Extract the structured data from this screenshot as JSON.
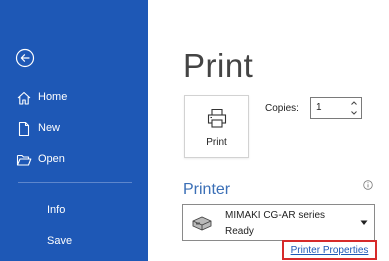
{
  "sidebar": {
    "back_icon": "back-arrow-icon",
    "items": [
      {
        "label": "Home",
        "icon": "home-icon"
      },
      {
        "label": "New",
        "icon": "new-document-icon"
      },
      {
        "label": "Open",
        "icon": "folder-open-icon"
      },
      {
        "label": "Info"
      },
      {
        "label": "Save"
      }
    ]
  },
  "main": {
    "title": "Print",
    "print_button_label": "Print",
    "copies_label": "Copies:",
    "copies_value": "1",
    "printer_section_title": "Printer",
    "printer": {
      "name": "MIMAKI CG-AR series",
      "status": "Ready"
    },
    "printer_properties_link": "Printer Properties"
  },
  "colors": {
    "sidebar_bg": "#1e58b6",
    "accent": "#3b6fb6",
    "highlight_border": "#d62a2a"
  }
}
